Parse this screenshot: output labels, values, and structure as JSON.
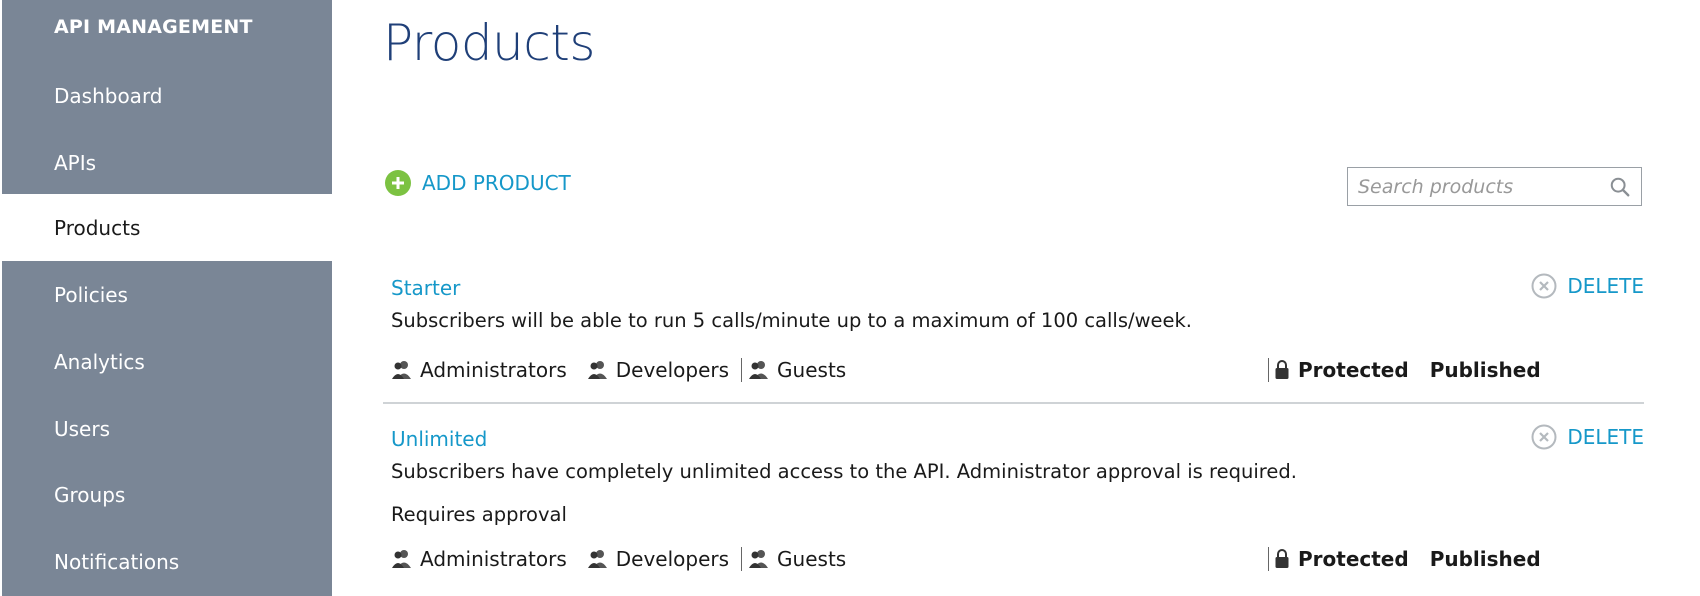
{
  "sidebar": {
    "brand": "API MANAGEMENT",
    "items": [
      {
        "label": "Dashboard",
        "active": false
      },
      {
        "label": "APIs",
        "active": false
      },
      {
        "label": "Products",
        "active": true
      },
      {
        "label": "Policies",
        "active": false
      },
      {
        "label": "Analytics",
        "active": false
      },
      {
        "label": "Users",
        "active": false
      },
      {
        "label": "Groups",
        "active": false
      },
      {
        "label": "Notifications",
        "active": false
      }
    ]
  },
  "main": {
    "title": "Products",
    "add_label": "ADD PRODUCT",
    "search": {
      "placeholder": "Search products",
      "value": ""
    },
    "products": [
      {
        "name": "Starter",
        "description": "Subscribers will be able to run 5 calls/minute up to a maximum of 100 calls/week.",
        "approval": "",
        "delete_label": "DELETE",
        "groups": [
          "Administrators",
          "Developers",
          "Guests"
        ],
        "protected": "Protected",
        "published": "Published"
      },
      {
        "name": "Unlimited",
        "description": "Subscribers have completely unlimited access to the API. Administrator approval is required.",
        "approval": "Requires approval",
        "delete_label": "DELETE",
        "groups": [
          "Administrators",
          "Developers",
          "Guests"
        ],
        "protected": "Protected",
        "published": "Published"
      }
    ]
  },
  "colors": {
    "sidebar_bg": "#7a8696",
    "accent": "#1698c9",
    "title": "#1f3f78",
    "add_icon": "#7cc242"
  }
}
